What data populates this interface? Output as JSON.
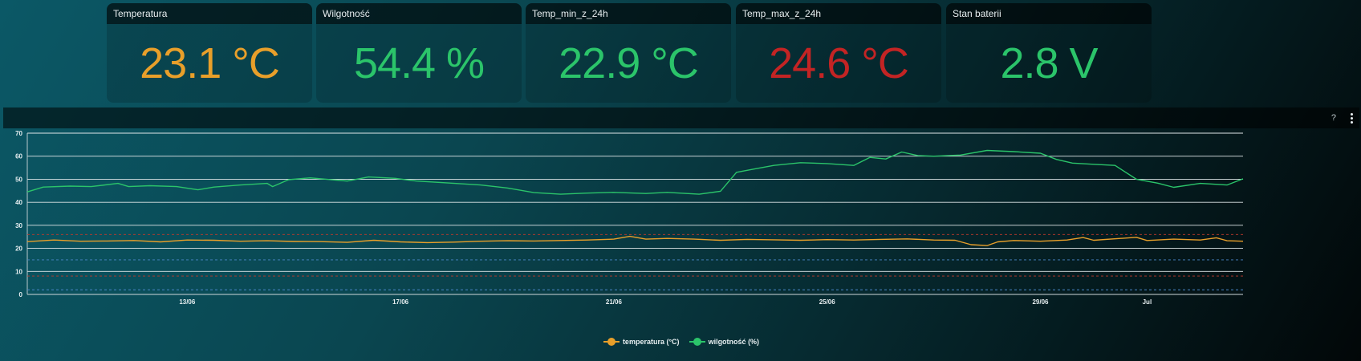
{
  "cards": [
    {
      "title": "Temperatura",
      "value": "23.1 °C",
      "color": "#e89f2a"
    },
    {
      "title": "Wilgotność",
      "value": "54.4 %",
      "color": "#2bc46a"
    },
    {
      "title": "Temp_min_z_24h",
      "value": "22.9 °C",
      "color": "#2bc46a"
    },
    {
      "title": "Temp_max_z_24h",
      "value": "24.6 °C",
      "color": "#c32424"
    },
    {
      "title": "Stan baterii",
      "value": "2.8 V",
      "color": "#2bc46a"
    }
  ],
  "panel": {
    "help": "?"
  },
  "chart_data": {
    "type": "line",
    "ylim": [
      0,
      70
    ],
    "yticks": [
      0,
      10,
      20,
      30,
      40,
      50,
      60,
      70
    ],
    "xlim": [
      0,
      22.8
    ],
    "xticks": [
      {
        "label": "13/06",
        "x": 3
      },
      {
        "label": "17/06",
        "x": 7
      },
      {
        "label": "21/06",
        "x": 11
      },
      {
        "label": "25/06",
        "x": 15
      },
      {
        "label": "29/06",
        "x": 19
      },
      {
        "label": "Jul",
        "x": 21
      }
    ],
    "grid": true,
    "legend": "bottom-center",
    "thresholds": [
      {
        "value": 26,
        "color": "#c0392b"
      },
      {
        "value": 15,
        "color": "#4a86c8"
      },
      {
        "value": 8,
        "color": "#c0392b"
      },
      {
        "value": 2,
        "color": "#4a86c8"
      }
    ],
    "series": [
      {
        "name": "temperatura (°C)",
        "color": "#e89f2a",
        "points": [
          [
            0,
            22.9
          ],
          [
            0.5,
            23.6
          ],
          [
            1,
            23.1
          ],
          [
            1.5,
            23.2
          ],
          [
            2,
            23.4
          ],
          [
            2.5,
            22.8
          ],
          [
            3,
            23.6
          ],
          [
            3.5,
            23.5
          ],
          [
            4,
            23.1
          ],
          [
            4.5,
            23.3
          ],
          [
            5,
            23.0
          ],
          [
            5.5,
            22.9
          ],
          [
            6,
            22.6
          ],
          [
            6.5,
            23.5
          ],
          [
            7,
            22.8
          ],
          [
            7.5,
            22.5
          ],
          [
            8,
            22.7
          ],
          [
            8.5,
            23.1
          ],
          [
            9,
            23.3
          ],
          [
            9.5,
            23.2
          ],
          [
            10,
            23.4
          ],
          [
            10.5,
            23.6
          ],
          [
            11,
            24.0
          ],
          [
            11.3,
            25.2
          ],
          [
            11.6,
            24.0
          ],
          [
            12,
            24.3
          ],
          [
            12.5,
            24.0
          ],
          [
            13,
            23.5
          ],
          [
            13.5,
            23.9
          ],
          [
            14,
            23.7
          ],
          [
            14.5,
            23.5
          ],
          [
            15,
            23.8
          ],
          [
            15.5,
            23.6
          ],
          [
            16,
            23.9
          ],
          [
            16.5,
            24.1
          ],
          [
            17,
            23.6
          ],
          [
            17.4,
            23.5
          ],
          [
            17.7,
            21.6
          ],
          [
            18,
            21.2
          ],
          [
            18.2,
            22.8
          ],
          [
            18.5,
            23.4
          ],
          [
            19,
            23.1
          ],
          [
            19.5,
            23.6
          ],
          [
            19.8,
            24.7
          ],
          [
            20,
            23.5
          ],
          [
            20.5,
            24.3
          ],
          [
            20.8,
            24.8
          ],
          [
            21,
            23.4
          ],
          [
            21.5,
            24.0
          ],
          [
            22,
            23.6
          ],
          [
            22.3,
            24.6
          ],
          [
            22.5,
            23.3
          ],
          [
            22.8,
            23.1
          ]
        ]
      },
      {
        "name": "wilgotność (%)",
        "color": "#2bc46a",
        "points": [
          [
            0,
            44.5
          ],
          [
            0.3,
            46.6
          ],
          [
            0.8,
            47.0
          ],
          [
            1.2,
            46.8
          ],
          [
            1.7,
            48.2
          ],
          [
            1.9,
            46.8
          ],
          [
            2.3,
            47.2
          ],
          [
            2.8,
            46.8
          ],
          [
            3.2,
            45.4
          ],
          [
            3.5,
            46.6
          ],
          [
            4,
            47.5
          ],
          [
            4.5,
            48.2
          ],
          [
            4.6,
            46.8
          ],
          [
            4.9,
            49.8
          ],
          [
            5.3,
            50.6
          ],
          [
            6,
            49.2
          ],
          [
            6.4,
            51.0
          ],
          [
            6.9,
            50.4
          ],
          [
            7.3,
            49.2
          ],
          [
            7.8,
            48.5
          ],
          [
            8.5,
            47.5
          ],
          [
            9,
            46.2
          ],
          [
            9.5,
            44.2
          ],
          [
            10,
            43.5
          ],
          [
            10.5,
            44.0
          ],
          [
            11,
            44.3
          ],
          [
            11.6,
            43.8
          ],
          [
            12,
            44.3
          ],
          [
            12.6,
            43.5
          ],
          [
            13,
            44.8
          ],
          [
            13.3,
            53.0
          ],
          [
            13.6,
            54.3
          ],
          [
            14,
            56.0
          ],
          [
            14.5,
            57.2
          ],
          [
            15,
            56.8
          ],
          [
            15.5,
            56.0
          ],
          [
            15.8,
            59.5
          ],
          [
            16.1,
            58.8
          ],
          [
            16.4,
            61.8
          ],
          [
            16.7,
            60.3
          ],
          [
            17,
            60.0
          ],
          [
            17.5,
            60.5
          ],
          [
            18,
            62.5
          ],
          [
            18.5,
            62.0
          ],
          [
            19,
            61.3
          ],
          [
            19.3,
            58.6
          ],
          [
            19.6,
            57.0
          ],
          [
            20,
            56.5
          ],
          [
            20.4,
            56.0
          ],
          [
            20.8,
            50.0
          ],
          [
            21.2,
            48.3
          ],
          [
            21.5,
            46.5
          ],
          [
            22,
            48.2
          ],
          [
            22.5,
            47.5
          ],
          [
            22.8,
            50.2
          ]
        ]
      }
    ]
  }
}
